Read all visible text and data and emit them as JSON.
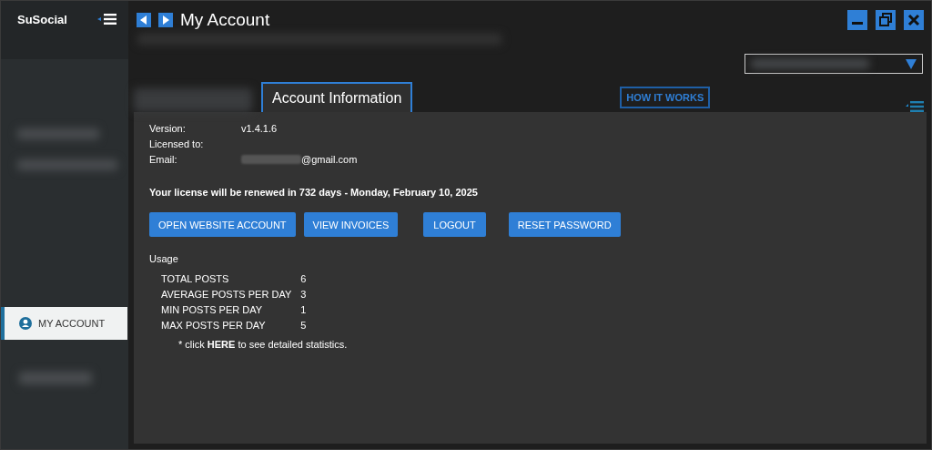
{
  "app": {
    "name": "SuSocial"
  },
  "sidebar": {
    "items": [
      {
        "label": "MY ACCOUNT",
        "selected": true
      }
    ]
  },
  "window": {
    "title": "My Account"
  },
  "tabs": [
    {
      "label": "Account Information",
      "selected": true
    }
  ],
  "help_button": "HOW IT WORKS",
  "account": {
    "fields": [
      {
        "label": "Version:",
        "value": "v1.4.1.6"
      },
      {
        "label": "Licensed to:"
      },
      {
        "label": "Email:",
        "value": "@gmail.com",
        "redacted": true
      }
    ]
  },
  "license_notice": "Your license will be renewed in 732 days -  Monday, February 10, 2025",
  "buttons": [
    "OPEN WEBSITE ACCOUNT",
    "VIEW INVOICES",
    "LOGOUT",
    "RESET PASSWORD"
  ],
  "usage": {
    "title": "Usage",
    "rows": [
      {
        "label": "TOTAL POSTS",
        "value": "6"
      },
      {
        "label": "AVERAGE POSTS PER DAY",
        "value": "3"
      },
      {
        "label": "MIN POSTS PER DAY",
        "value": "1"
      },
      {
        "label": "MAX POSTS PER DAY",
        "value": "5"
      }
    ],
    "note": "* click **HERE** to see detailed statistics."
  }
}
